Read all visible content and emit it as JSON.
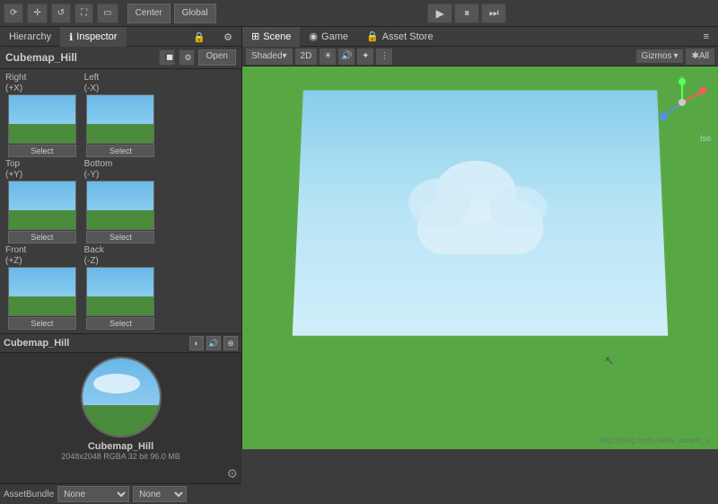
{
  "toolbar": {
    "center_label": "Center",
    "global_label": "Global",
    "play_btn": "▶",
    "pause_btn": "⏸",
    "step_btn": "⏭"
  },
  "left_panel": {
    "tabs": [
      {
        "label": "Hierarchy",
        "active": false
      },
      {
        "label": "Inspector",
        "active": true
      }
    ],
    "inspector": {
      "title": "Cubemap_Hill",
      "open_btn": "Open"
    },
    "cube_faces": [
      {
        "id": "right",
        "label_line1": "Right",
        "label_line2": "(+X)",
        "has_preview": true,
        "select_label": "Select",
        "grid_col": 1,
        "grid_row": 1
      },
      {
        "id": "left",
        "label_line1": "Left",
        "label_line2": "(-X)",
        "has_preview": true,
        "select_label": "Select",
        "grid_col": 2,
        "grid_row": 1
      },
      {
        "id": "empty_top_right",
        "empty": true,
        "grid_col": 3,
        "grid_row": 1
      },
      {
        "id": "top",
        "label_line1": "Top",
        "label_line2": "(+Y)",
        "has_preview": true,
        "select_label": "Select",
        "grid_col": 1,
        "grid_row": 2
      },
      {
        "id": "bottom",
        "label_line1": "Bottom",
        "label_line2": "(-Y)",
        "has_preview": true,
        "select_label": "Select",
        "grid_col": 2,
        "grid_row": 2
      },
      {
        "id": "empty_mid_right",
        "empty": true,
        "grid_col": 3,
        "grid_row": 2
      },
      {
        "id": "front",
        "label_line1": "Front",
        "label_line2": "(+Z)",
        "has_preview": true,
        "select_label": "Select",
        "grid_col": 1,
        "grid_row": 3
      },
      {
        "id": "back",
        "label_line1": "Back",
        "label_line2": "(-Z)",
        "has_preview": true,
        "select_label": "Select",
        "grid_col": 2,
        "grid_row": 3
      },
      {
        "id": "empty_bot_right",
        "empty": true,
        "grid_col": 3,
        "grid_row": 3
      }
    ],
    "preview": {
      "name": "Cubemap_Hill",
      "info_line1": "2048x2048  RGBA 32 bit  96.0 MB"
    },
    "asset_bundle": {
      "label": "AssetBundle",
      "option1": "None",
      "option2": "None"
    }
  },
  "right_panel": {
    "tabs": [
      {
        "label": "Scene",
        "icon": "⊞",
        "active": true
      },
      {
        "label": "Game",
        "icon": "◉",
        "active": false
      },
      {
        "label": "Asset Store",
        "icon": "🔒",
        "active": false
      }
    ],
    "toolbar": {
      "shaded": "Shaded",
      "mode_2d": "2D",
      "gizmos": "Gizmos ▾",
      "all_label": "✱All"
    },
    "scene": {
      "iso_label": "Iso",
      "url_watermark": "http://blog.csdn.net/v_xchen_v"
    }
  }
}
